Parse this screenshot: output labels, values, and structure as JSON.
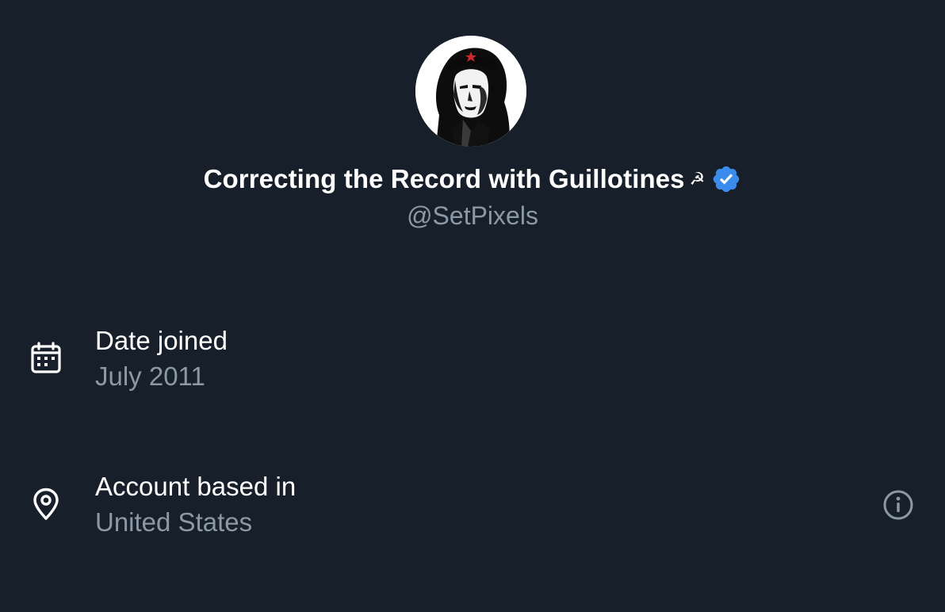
{
  "profile": {
    "display_name": "Correcting the Record with Guillotines",
    "name_emoji": "☭",
    "handle": "@SetPixels",
    "verified_color": "#3b8bec"
  },
  "details": {
    "date_joined": {
      "label": "Date joined",
      "value": "July 2011",
      "icon": "calendar-icon"
    },
    "account_location": {
      "label": "Account based in",
      "value": "United States",
      "icon": "location-pin-icon"
    }
  },
  "colors": {
    "background": "#17202a",
    "primary_text": "#ffffff",
    "secondary_text": "#8b98a5"
  }
}
